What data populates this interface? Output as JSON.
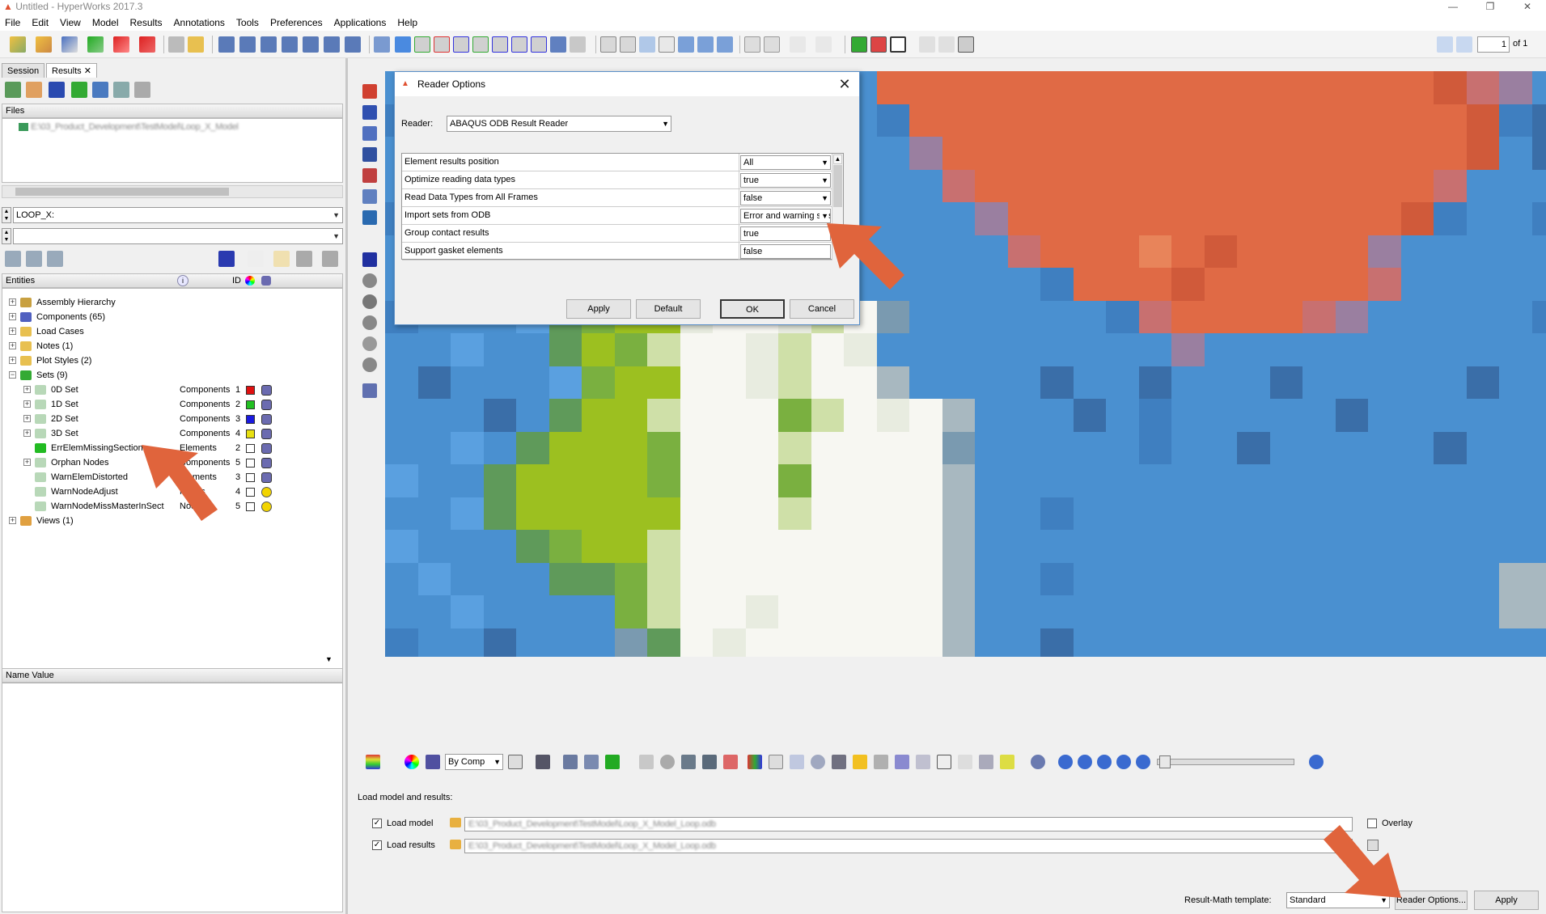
{
  "window": {
    "title": "Untitled - HyperWorks 2017.3"
  },
  "menu": [
    "File",
    "Edit",
    "View",
    "Model",
    "Results",
    "Annotations",
    "Tools",
    "Preferences",
    "Applications",
    "Help"
  ],
  "toolbar": {
    "page_value": "1",
    "page_of": "of 1"
  },
  "left_panel": {
    "tabs": [
      "Session",
      "Results"
    ],
    "files_header": "Files",
    "file_path_blurred": "E:\\03_Product_Development\\TestModel\\Loop_X_Model",
    "loop_combo": "LOOP_X:",
    "second_combo": "",
    "entities_header": "Entities",
    "id_header": "ID",
    "tree": [
      {
        "label": "Assembly Hierarchy",
        "level": 0,
        "icon": "assembly-icon"
      },
      {
        "label": "Components (65)",
        "level": 0,
        "icon": "components-icon"
      },
      {
        "label": "Load Cases",
        "level": 0,
        "icon": "folder-icon"
      },
      {
        "label": "Notes (1)",
        "level": 0,
        "icon": "folder-icon"
      },
      {
        "label": "Plot Styles (2)",
        "level": 0,
        "icon": "folder-icon"
      },
      {
        "label": "Sets (9)",
        "level": 0,
        "icon": "sets-icon"
      },
      {
        "label": "0D Set",
        "level": 1,
        "type": "Components",
        "id": "1",
        "color": "#e01010",
        "marker": "cube"
      },
      {
        "label": "1D Set",
        "level": 1,
        "type": "Components",
        "id": "2",
        "color": "#22c022",
        "marker": "cube"
      },
      {
        "label": "2D Set",
        "level": 1,
        "type": "Components",
        "id": "3",
        "color": "#1a1ae0",
        "marker": "cube"
      },
      {
        "label": "3D Set",
        "level": 1,
        "type": "Components",
        "id": "4",
        "color": "#e8e010",
        "marker": "cube"
      },
      {
        "label": "ErrElemMissingSection",
        "level": 1,
        "type": "Elements",
        "id": "2",
        "color": "#ffffff",
        "marker": "cube"
      },
      {
        "label": "Orphan Nodes",
        "level": 1,
        "type": "Components",
        "id": "5",
        "color": "#ffffff",
        "marker": "cube"
      },
      {
        "label": "WarnElemDistorted",
        "level": 1,
        "type": "Elements",
        "id": "3",
        "color": "#ffffff",
        "marker": "cube"
      },
      {
        "label": "WarnNodeAdjust",
        "level": 1,
        "type": "Nodes",
        "id": "4",
        "color": "#ffffff",
        "marker": "dot"
      },
      {
        "label": "WarnNodeMissMasterInSect",
        "level": 1,
        "type": "Nodes",
        "id": "5",
        "color": "#ffffff",
        "marker": "dot"
      },
      {
        "label": "Views (1)",
        "level": 0,
        "icon": "views-icon"
      }
    ],
    "props_header_name": "Name",
    "props_header_value": "Value"
  },
  "dialog": {
    "title": "Reader Options",
    "reader_label": "Reader:",
    "reader_value": "ABAQUS ODB Result Reader",
    "properties": [
      {
        "name": "Element results position",
        "value": "All"
      },
      {
        "name": "Optimize reading data types",
        "value": "true"
      },
      {
        "name": "Read Data Types from All Frames",
        "value": "false"
      },
      {
        "name": "Import sets from ODB",
        "value": "Error and warning sets"
      },
      {
        "name": "Group contact results",
        "value": "true"
      },
      {
        "name": "Support gasket elements",
        "value": "false"
      }
    ],
    "buttons": {
      "apply": "Apply",
      "default": "Default",
      "ok": "OK",
      "cancel": "Cancel"
    }
  },
  "bottom_toolbar": {
    "color_by": "By Comp"
  },
  "load_panel": {
    "heading": "Load model and results:",
    "load_model_label": "Load model",
    "load_results_label": "Load results",
    "model_path": "E:\\03_Product_Development\\TestModel\\Loop_X_Model_Loop.odb",
    "results_path": "E:\\03_Product_Development\\TestModel\\Loop_X_Model_Loop.odb",
    "overlay_label": "Overlay",
    "result_math_label": "Result-Math template:",
    "result_math_value": "Standard",
    "reader_options_button": "Reader Options...",
    "apply_button": "Apply"
  },
  "colors": {
    "annotation_arrow": "#e0643c",
    "dialog_border": "#5a8fc8",
    "viewport_blue": "#4a90d0",
    "contour_red": "#e06a45"
  }
}
